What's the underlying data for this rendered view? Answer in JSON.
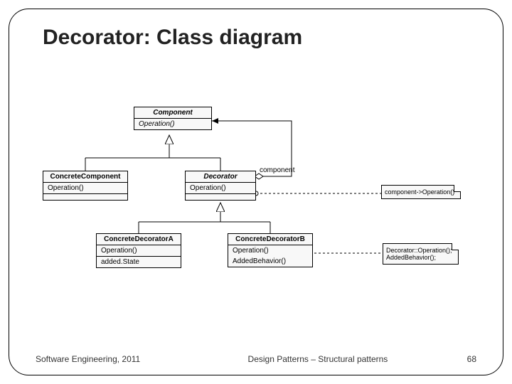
{
  "title": "Decorator: Class diagram",
  "footer": {
    "left": "Software Engineering, 2011",
    "center": "Design Patterns – Structural patterns",
    "page": "68"
  },
  "uml": {
    "component": {
      "name": "Component",
      "ops": [
        "Operation()"
      ]
    },
    "concreteComponent": {
      "name": "ConcreteComponent",
      "ops": [
        "Operation()"
      ]
    },
    "decorator": {
      "name": "Decorator",
      "ops": [
        "Operation()"
      ]
    },
    "concreteDecoratorA": {
      "name": "ConcreteDecoratorA",
      "ops": [
        "Operation()"
      ],
      "attrs": [
        "added.State"
      ]
    },
    "concreteDecoratorB": {
      "name": "ConcreteDecoratorB",
      "ops": [
        "Operation()",
        "AddedBehavior()"
      ]
    },
    "aggLabel": "component",
    "note1": "component->Operation()",
    "note2a": "Decorator::Operation();",
    "note2b": "AddedBehavior();"
  }
}
